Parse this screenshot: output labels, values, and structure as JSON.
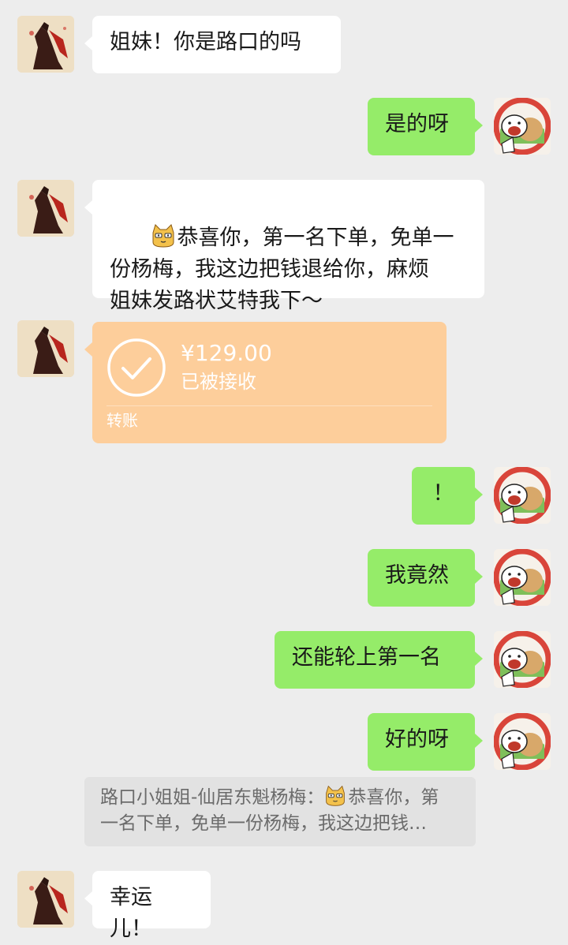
{
  "messages": [
    {
      "side": "left",
      "text": "姐妹！你是路口的吗"
    },
    {
      "side": "right",
      "text": "是的呀"
    },
    {
      "side": "left",
      "text": "恭喜你，第一名下单，免单一\n份杨梅，我这边把钱退给你，麻烦\n姐妹发路状艾特我下～",
      "emoji": "cat-emoji"
    },
    {
      "side": "left",
      "type": "transfer"
    },
    {
      "side": "right",
      "text": "！"
    },
    {
      "side": "right",
      "text": "我竟然"
    },
    {
      "side": "right",
      "text": "还能轮上第一名"
    },
    {
      "side": "right",
      "text": "好的呀"
    },
    {
      "side": "left",
      "text": "幸运儿！"
    }
  ],
  "transfer": {
    "amount": "¥129.00",
    "status": "已被接收",
    "label": "转账"
  },
  "quote": {
    "line1_prefix": "路口小姐姐-仙居东魁杨梅：",
    "line1_suffix": "恭喜你，第",
    "line2": "一名下单，免单一份杨梅，我这边把钱…"
  },
  "colors": {
    "background": "#ededed",
    "bubble_left": "#ffffff",
    "bubble_right": "#95ec69",
    "transfer": "#fdce9b",
    "quote_bg": "#e2e2e2"
  },
  "icons": {
    "left_avatar": "avatar-horse-rider",
    "right_avatar": "avatar-bear-cartoon",
    "emoji": "cat-emoji",
    "transfer_icon": "check-circle-icon"
  }
}
